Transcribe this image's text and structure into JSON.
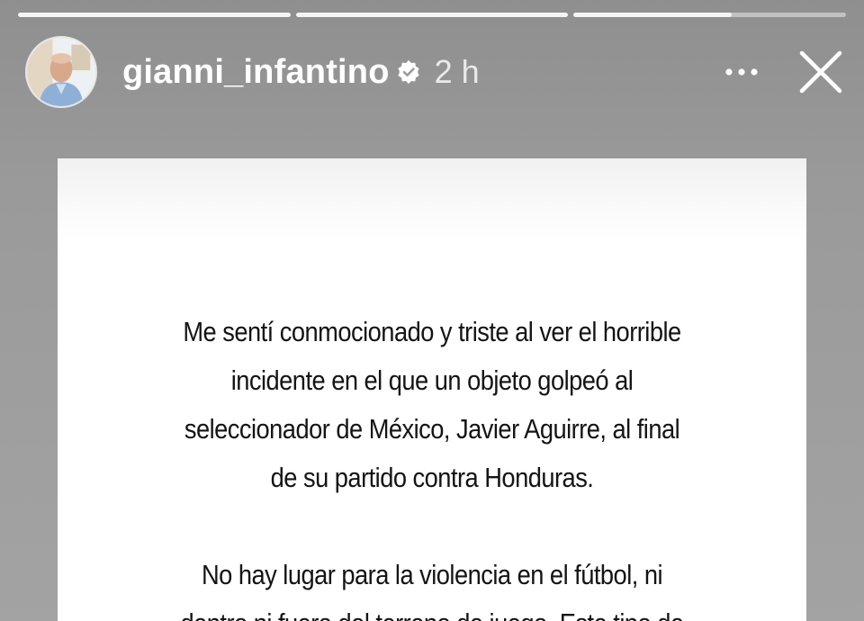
{
  "story": {
    "progress": [
      1.0,
      1.0,
      0.58
    ],
    "username": "gianni_infantino",
    "verified": true,
    "timestamp": "2 h",
    "icons": {
      "avatar": "profile-photo",
      "verified": "verified-badge-icon",
      "more": "more-horizontal-icon",
      "close": "close-icon"
    },
    "paragraphs": [
      {
        "lines": [
          "Me sentí conmocionado y triste al ver el horrible",
          "incidente en el que un objeto golpeó al",
          "seleccionador de México, Javier Aguirre, al final",
          "de su partido contra Honduras."
        ]
      },
      {
        "lines": [
          "No hay lugar para la violencia en el fútbol, ni",
          "dentro ni fuera del terreno de juego. Este tipo de"
        ]
      }
    ]
  },
  "colors": {
    "background": "#9a9a9a",
    "card": "#ffffff",
    "text": "#141414",
    "header_text": "#ffffff"
  }
}
